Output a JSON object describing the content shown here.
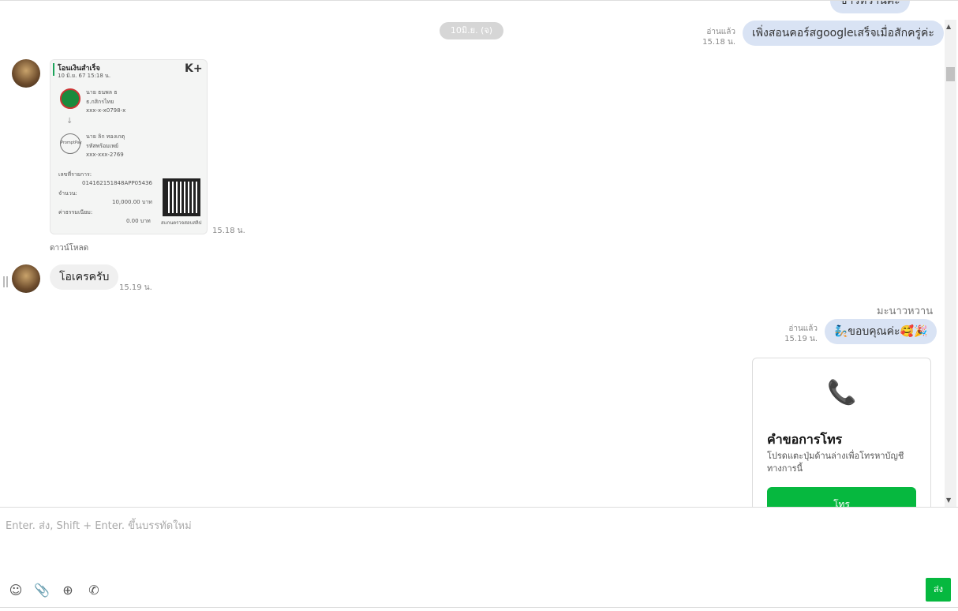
{
  "messages": {
    "top_cut_text": "ขาวหวานค่ะ",
    "date_divider": "10มิ.ย. (จ)",
    "msg1": {
      "status": "อ่านแล้ว",
      "time": "15.18 น.",
      "text": "เพิ่งสอนคอร์สgoogleเสร็จเมื่อสักครู่ค่ะ"
    },
    "slip": {
      "title": "โอนเงินสำเร็จ",
      "datetime": "10 มิ.ย. 67 15:18 น.",
      "brand": "K+",
      "from_name": "นาย ธนพล ธ",
      "from_bank": "ธ.กสิกรไทย",
      "from_account": "xxx-x-x0798-x",
      "to_name": "นาย ลิก ทองเกตุ",
      "to_bank": "รหัสพร้อมเพย์",
      "to_account": "xxx-xxx-2769",
      "promptpay": "PromptPay",
      "ref_label": "เลขที่รายการ:",
      "ref": "014162151848APP05436",
      "amount_label": "จำนวน:",
      "amount": "10,000.00 บาท",
      "fee_label": "ค่าธรรมเนียม:",
      "fee": "0.00 บาท",
      "qr_caption": "สแกนตรวจสอบสลิป",
      "time": "15.18 น.",
      "download": "ดาวน์โหลด"
    },
    "msg2": {
      "text": "โอเครครับ",
      "time": "15.19 น."
    },
    "sender_name": "มะนาวหวาน",
    "msg3": {
      "status": "อ่านแล้ว",
      "time": "15.19 น.",
      "text": "🧞ขอบคุณค่ะ🥰🎉"
    },
    "call_card": {
      "title": "คำขอการโทร",
      "desc": "โปรดแตะปุ่มด้านล่างเพื่อโทรหาบัญชีทางการนี้",
      "button": "โทร"
    }
  },
  "composer": {
    "placeholder": "Enter. ส่ง, Shift + Enter. ขึ้นบรรทัดใหม่",
    "send": "ส่ง"
  },
  "colors": {
    "accent": "#06b83f",
    "bubble_self": "#d9e3f4"
  }
}
